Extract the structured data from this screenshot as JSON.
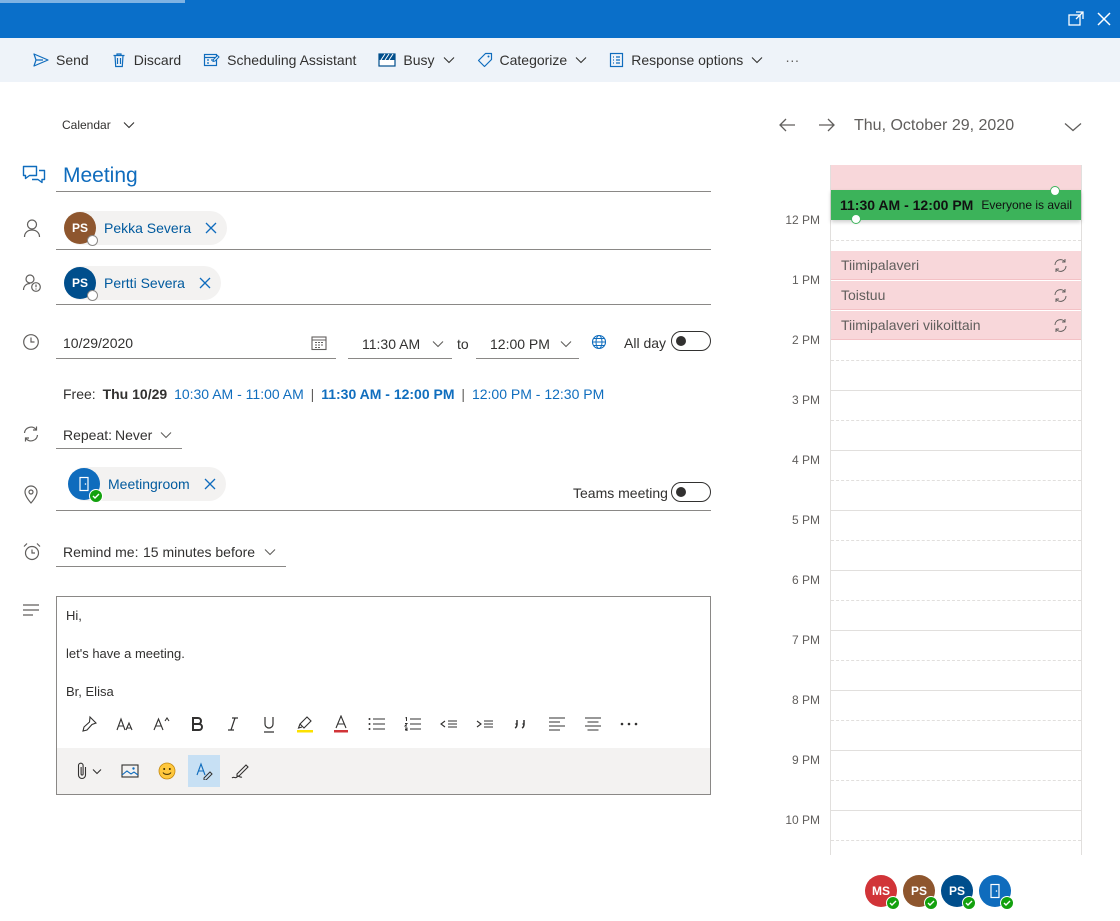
{
  "toolbar": {
    "send": "Send",
    "discard": "Discard",
    "scheduling_assistant": "Scheduling Assistant",
    "busy": "Busy",
    "categorize": "Categorize",
    "response_options": "Response options",
    "more": "···"
  },
  "form": {
    "calendar_label": "Calendar",
    "title": "Meeting",
    "required_attendee": {
      "initials": "PS",
      "name": "Pekka Severa",
      "color": "#8e562e"
    },
    "optional_attendee": {
      "initials": "PS",
      "name": "Pertti Severa",
      "color": "#004e8c"
    },
    "date": "10/29/2020",
    "start_time": "11:30 AM",
    "to_label": "to",
    "end_time": "12:00 PM",
    "all_day_label": "All day",
    "free_label": "Free:",
    "free_day": "Thu 10/29",
    "free_slots": [
      "10:30 AM - 11:00 AM",
      "11:30 AM - 12:00 PM",
      "12:00 PM - 12:30 PM"
    ],
    "separator": "|",
    "repeat_label": "Repeat:",
    "repeat_value": "Never",
    "location": {
      "name": "Meetingroom",
      "color": "#0f6cbd"
    },
    "teams_label": "Teams meeting",
    "remind_label": "Remind me:",
    "remind_value": "15 minutes before",
    "body_lines": [
      "Hi,",
      "let's have a meeting.",
      "Br, Elisa"
    ]
  },
  "calendar": {
    "date_title": "Thu, October 29, 2020",
    "hours": [
      "12 PM",
      "1 PM",
      "2 PM",
      "3 PM",
      "4 PM",
      "5 PM",
      "6 PM",
      "7 PM",
      "8 PM",
      "9 PM",
      "10 PM"
    ],
    "selected_event": {
      "time": "11:30 AM - 12:00 PM",
      "status": "Everyone is avail"
    },
    "events": [
      "Tiimipalaveri",
      "Toistuu",
      "Tiimipalaveri viikoittain"
    ],
    "attendees": [
      {
        "initials": "MS",
        "color": "#d13438"
      },
      {
        "initials": "PS",
        "color": "#8e562e"
      },
      {
        "initials": "PS",
        "color": "#004e8c"
      },
      {
        "initials": "",
        "color": "#0f6cbd"
      }
    ]
  }
}
